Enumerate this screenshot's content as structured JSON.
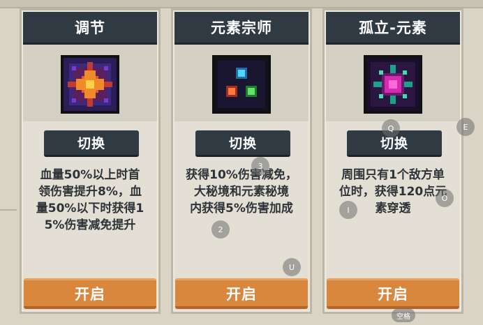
{
  "cards": [
    {
      "title": "调节",
      "icon": "radiant-star-icon",
      "switch_label": "切换",
      "description": "血量50%以上时首\n领伤害提升8%，血\n量50%以下时获得1\n5%伤害减免提升",
      "enable_label": "开启"
    },
    {
      "title": "元素宗师",
      "icon": "three-element-orbs-icon",
      "switch_label": "切换",
      "description": "获得10%伤害减免，\n大秘境和元素秘境\n内获得5%伤害加成",
      "enable_label": "开启"
    },
    {
      "title": "孤立-元素",
      "icon": "pink-crystal-icon",
      "switch_label": "切换",
      "description": "周围只有1个敌方单\n位时，获得120点元\n素穿透",
      "enable_label": "开启"
    }
  ],
  "key_hints": {
    "q": "Q",
    "e": "E",
    "k3": "3",
    "k2": "2",
    "i": "I",
    "o": "O",
    "u": "U",
    "space": "空格"
  },
  "colors": {
    "header": "#2f3a42",
    "enable": "#d9873d",
    "background": "#d9d4c6"
  }
}
